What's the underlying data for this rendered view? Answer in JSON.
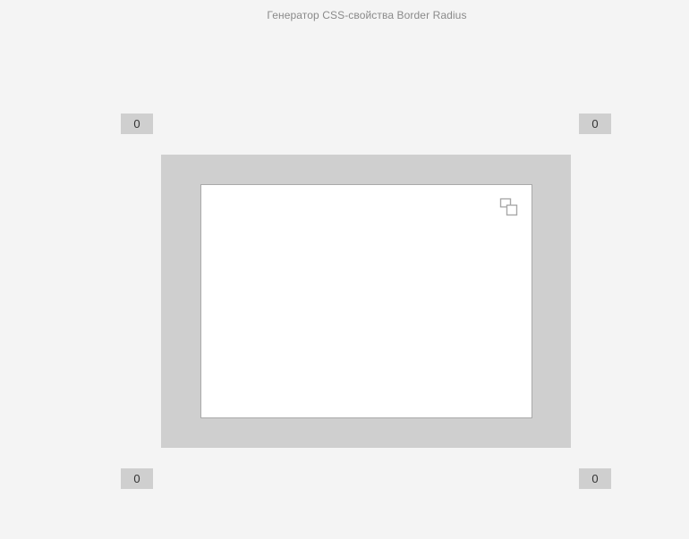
{
  "header": {
    "title": "Генератор CSS-свойства Border Radius"
  },
  "corners": {
    "top_left": "0",
    "top_right": "0",
    "bottom_left": "0",
    "bottom_right": "0"
  },
  "preview": {
    "icon": "copy-icon"
  },
  "colors": {
    "background": "#f4f4f4",
    "frame": "#cfcfcf",
    "preview": "#ffffff",
    "input_bg": "#cfcfcf"
  }
}
